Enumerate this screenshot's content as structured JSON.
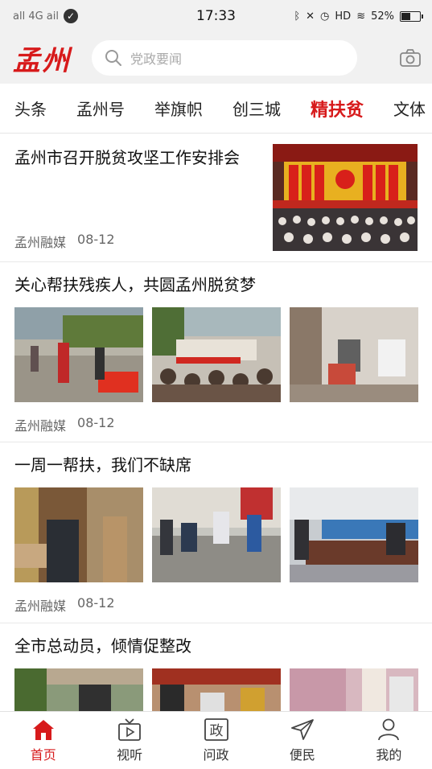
{
  "status_bar": {
    "left_text": "all 4G ail",
    "time": "17:33",
    "right_text": "HD",
    "battery": "52%"
  },
  "header": {
    "logo": "孟州",
    "search_placeholder": "党政要闻"
  },
  "tabs": [
    {
      "label": "头条",
      "active": false
    },
    {
      "label": "孟州号",
      "active": false
    },
    {
      "label": "举旗帜",
      "active": false
    },
    {
      "label": "创三城",
      "active": false
    },
    {
      "label": "精扶贫",
      "active": true
    },
    {
      "label": "文体",
      "active": false
    }
  ],
  "articles": [
    {
      "title": "孟州市召开脱贫攻坚工作安排会",
      "source": "孟州融媒",
      "date": "08-12"
    },
    {
      "title": "关心帮扶残疾人，共圆孟州脱贫梦",
      "source": "孟州融媒",
      "date": "08-12"
    },
    {
      "title": "一周一帮扶，我们不缺席",
      "source": "孟州融媒",
      "date": "08-12"
    },
    {
      "title": "全市总动员，倾情促整改"
    }
  ],
  "bottom_nav": [
    {
      "label": "首页",
      "icon": "home-icon",
      "active": true
    },
    {
      "label": "视听",
      "icon": "tv-icon",
      "active": false
    },
    {
      "label": "问政",
      "icon": "zheng-icon",
      "glyph": "政",
      "active": false
    },
    {
      "label": "便民",
      "icon": "send-icon",
      "active": false
    },
    {
      "label": "我的",
      "icon": "user-icon",
      "active": false
    }
  ],
  "colors": {
    "accent": "#d71a1b",
    "header_bg": "#f1f1f1"
  }
}
